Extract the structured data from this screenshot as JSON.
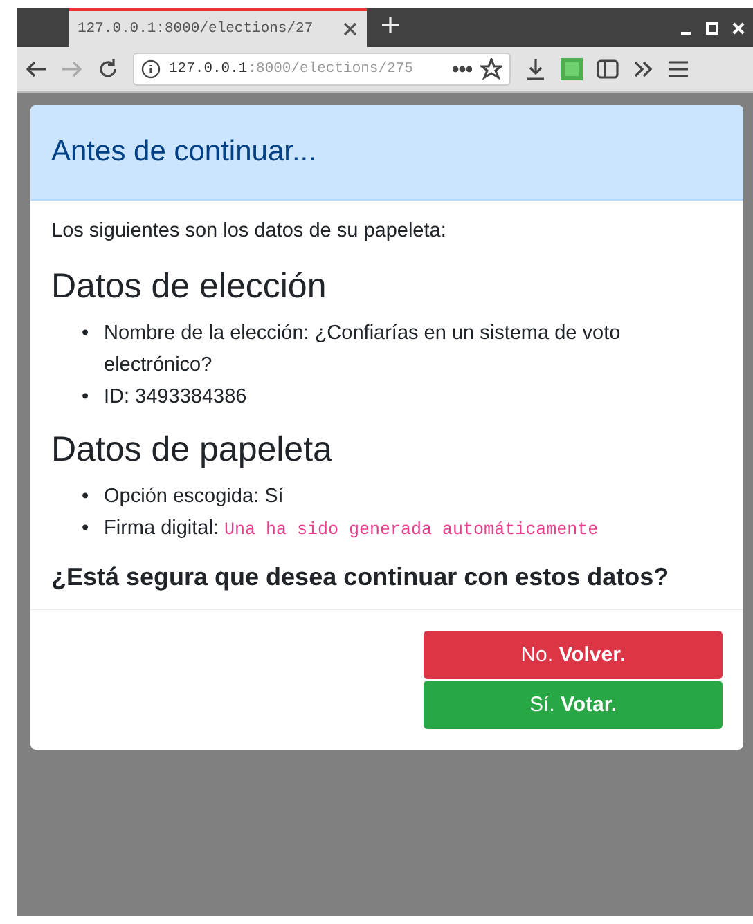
{
  "browser": {
    "tab": {
      "title": "127.0.0.1:8000/elections/27",
      "selected": true
    },
    "address": {
      "host": "127.0.0.1",
      "path": ":8000/elections/275"
    },
    "forward_disabled": true
  },
  "modal": {
    "title": "Antes de continuar...",
    "intro": "Los siguientes son los datos de su papeleta:",
    "sections": [
      {
        "heading": "Datos de elección",
        "items": [
          {
            "kind": "text",
            "bullet": "•",
            "text": "Nombre de la elección: ¿Confiarías en un sistema de voto electrónico?"
          },
          {
            "kind": "text",
            "bullet": "•",
            "text": "ID: 3493384386"
          }
        ]
      },
      {
        "heading": "Datos de papeleta",
        "items": [
          {
            "kind": "text",
            "bullet": "•",
            "text": "Opción escogida: Sí"
          },
          {
            "kind": "code",
            "bullet": "•",
            "label": "Firma digital:",
            "code": "Una ha sido generada automáticamente"
          }
        ]
      }
    ],
    "question": "¿Está segura que desea continuar con estos datos?",
    "buttons": [
      {
        "kind": "danger",
        "label": "No. **Volver.**"
      },
      {
        "kind": "success",
        "label": "Sí. **Votar.**"
      }
    ]
  }
}
